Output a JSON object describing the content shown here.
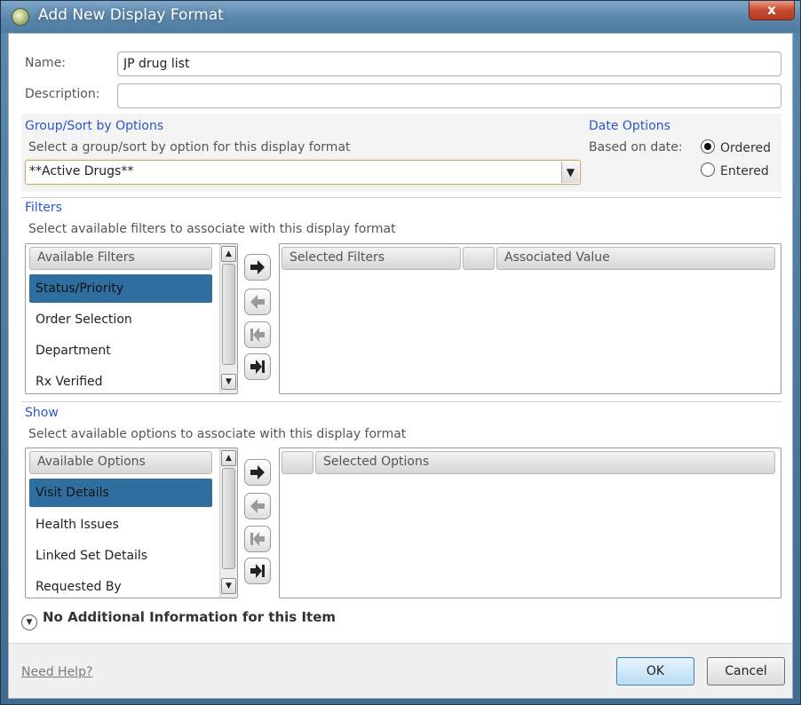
{
  "window": {
    "title": "Add New Display Format",
    "close_label": "x"
  },
  "form": {
    "name_label": "Name:",
    "name_value": "JP drug list",
    "description_label": "Description:",
    "description_value": ""
  },
  "group_sort": {
    "heading": "Group/Sort by Options",
    "subtext": "Select a group/sort by option for this display format",
    "selected_value": "**Active Drugs**"
  },
  "date_options": {
    "heading": "Date Options",
    "based_on_label": "Based on date:",
    "options": [
      {
        "label": "Ordered",
        "checked": true
      },
      {
        "label": "Entered",
        "checked": false
      }
    ]
  },
  "filters": {
    "heading": "Filters",
    "subtext": "Select available filters to associate with this display format",
    "available_header": "Available Filters",
    "available_items": [
      "Status/Priority",
      "Order Selection",
      "Department",
      "Rx Verified"
    ],
    "selected_index": 0,
    "selected_header": "Selected Filters",
    "associated_header": "Associated Value"
  },
  "show": {
    "heading": "Show",
    "subtext": "Select available options to associate with this display format",
    "available_header": "Available Options",
    "available_items": [
      "Visit Details",
      "Health Issues",
      "Linked Set Details",
      "Requested By"
    ],
    "selected_index": 0,
    "selected_header": "Selected Options"
  },
  "additional_info": {
    "label": "No Additional Information for this Item"
  },
  "footer": {
    "help_link": "Need Help?",
    "ok_label": "OK",
    "cancel_label": "Cancel"
  },
  "colors": {
    "accent_heading": "#2a56c6",
    "selection": "#2f6f9f",
    "title_bar": "#5a86ac"
  }
}
